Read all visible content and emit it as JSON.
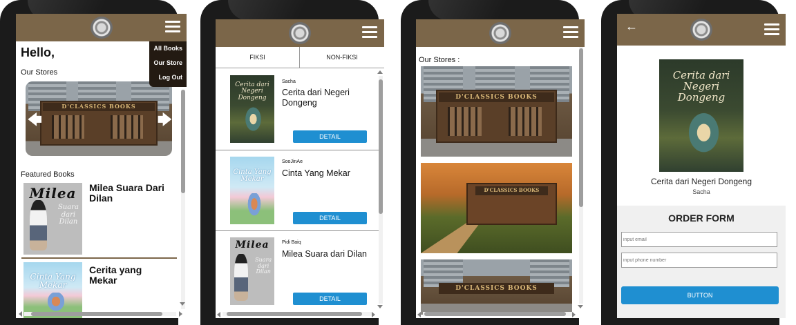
{
  "phone1": {
    "greeting": "Hello,",
    "menu": [
      "All Books",
      "Our Store",
      "Log Out"
    ],
    "our_stores_label": "Our Stores",
    "carousel_sign": "D'CLASSICS BOOKS",
    "featured_label": "Featured Books",
    "featured": [
      {
        "title": "Milea Suara Dari Dilan"
      },
      {
        "title": "Cerita yang Mekar"
      }
    ]
  },
  "phone2": {
    "tabs": [
      "FIKSI",
      "NON-FIKSI"
    ],
    "books": [
      {
        "author": "Sacha",
        "title": "Cerita dari Negeri Dongeng",
        "button": "DETAIL"
      },
      {
        "author": "SooJinAe",
        "title": "Cinta Yang Mekar",
        "button": "DETAIL"
      },
      {
        "author": "Pidi Baiq",
        "title": "Milea Suara dari Dilan",
        "button": "DETAIL"
      }
    ]
  },
  "phone3": {
    "heading": "Our Stores :",
    "signs": [
      "D'CLASSICS BOOKS",
      "D'CLASSICS BOOKS",
      "D'CLASSICS BOOKS"
    ]
  },
  "phone4": {
    "book_title": "Cerita dari Negeri Dongeng",
    "author": "Sacha",
    "order_title": "ORDER FORM",
    "email_placeholder": "input email",
    "phone_placeholder": "input phone number",
    "submit_label": "BUTTON"
  },
  "covers": {
    "cerita": "Cerita dari Negeri Dongeng",
    "cerita_lines": [
      "Cerita dari",
      "Negeri",
      "Dongeng"
    ],
    "cinta_lines": [
      "Cinta Yang",
      "Mekar"
    ],
    "milea": "Milea",
    "milea_sub": [
      "Suara",
      "dari",
      "Dilan"
    ]
  },
  "colors": {
    "appbar": "#7b6649",
    "button": "#1f8fd1",
    "menu_bg": "#231a12"
  }
}
